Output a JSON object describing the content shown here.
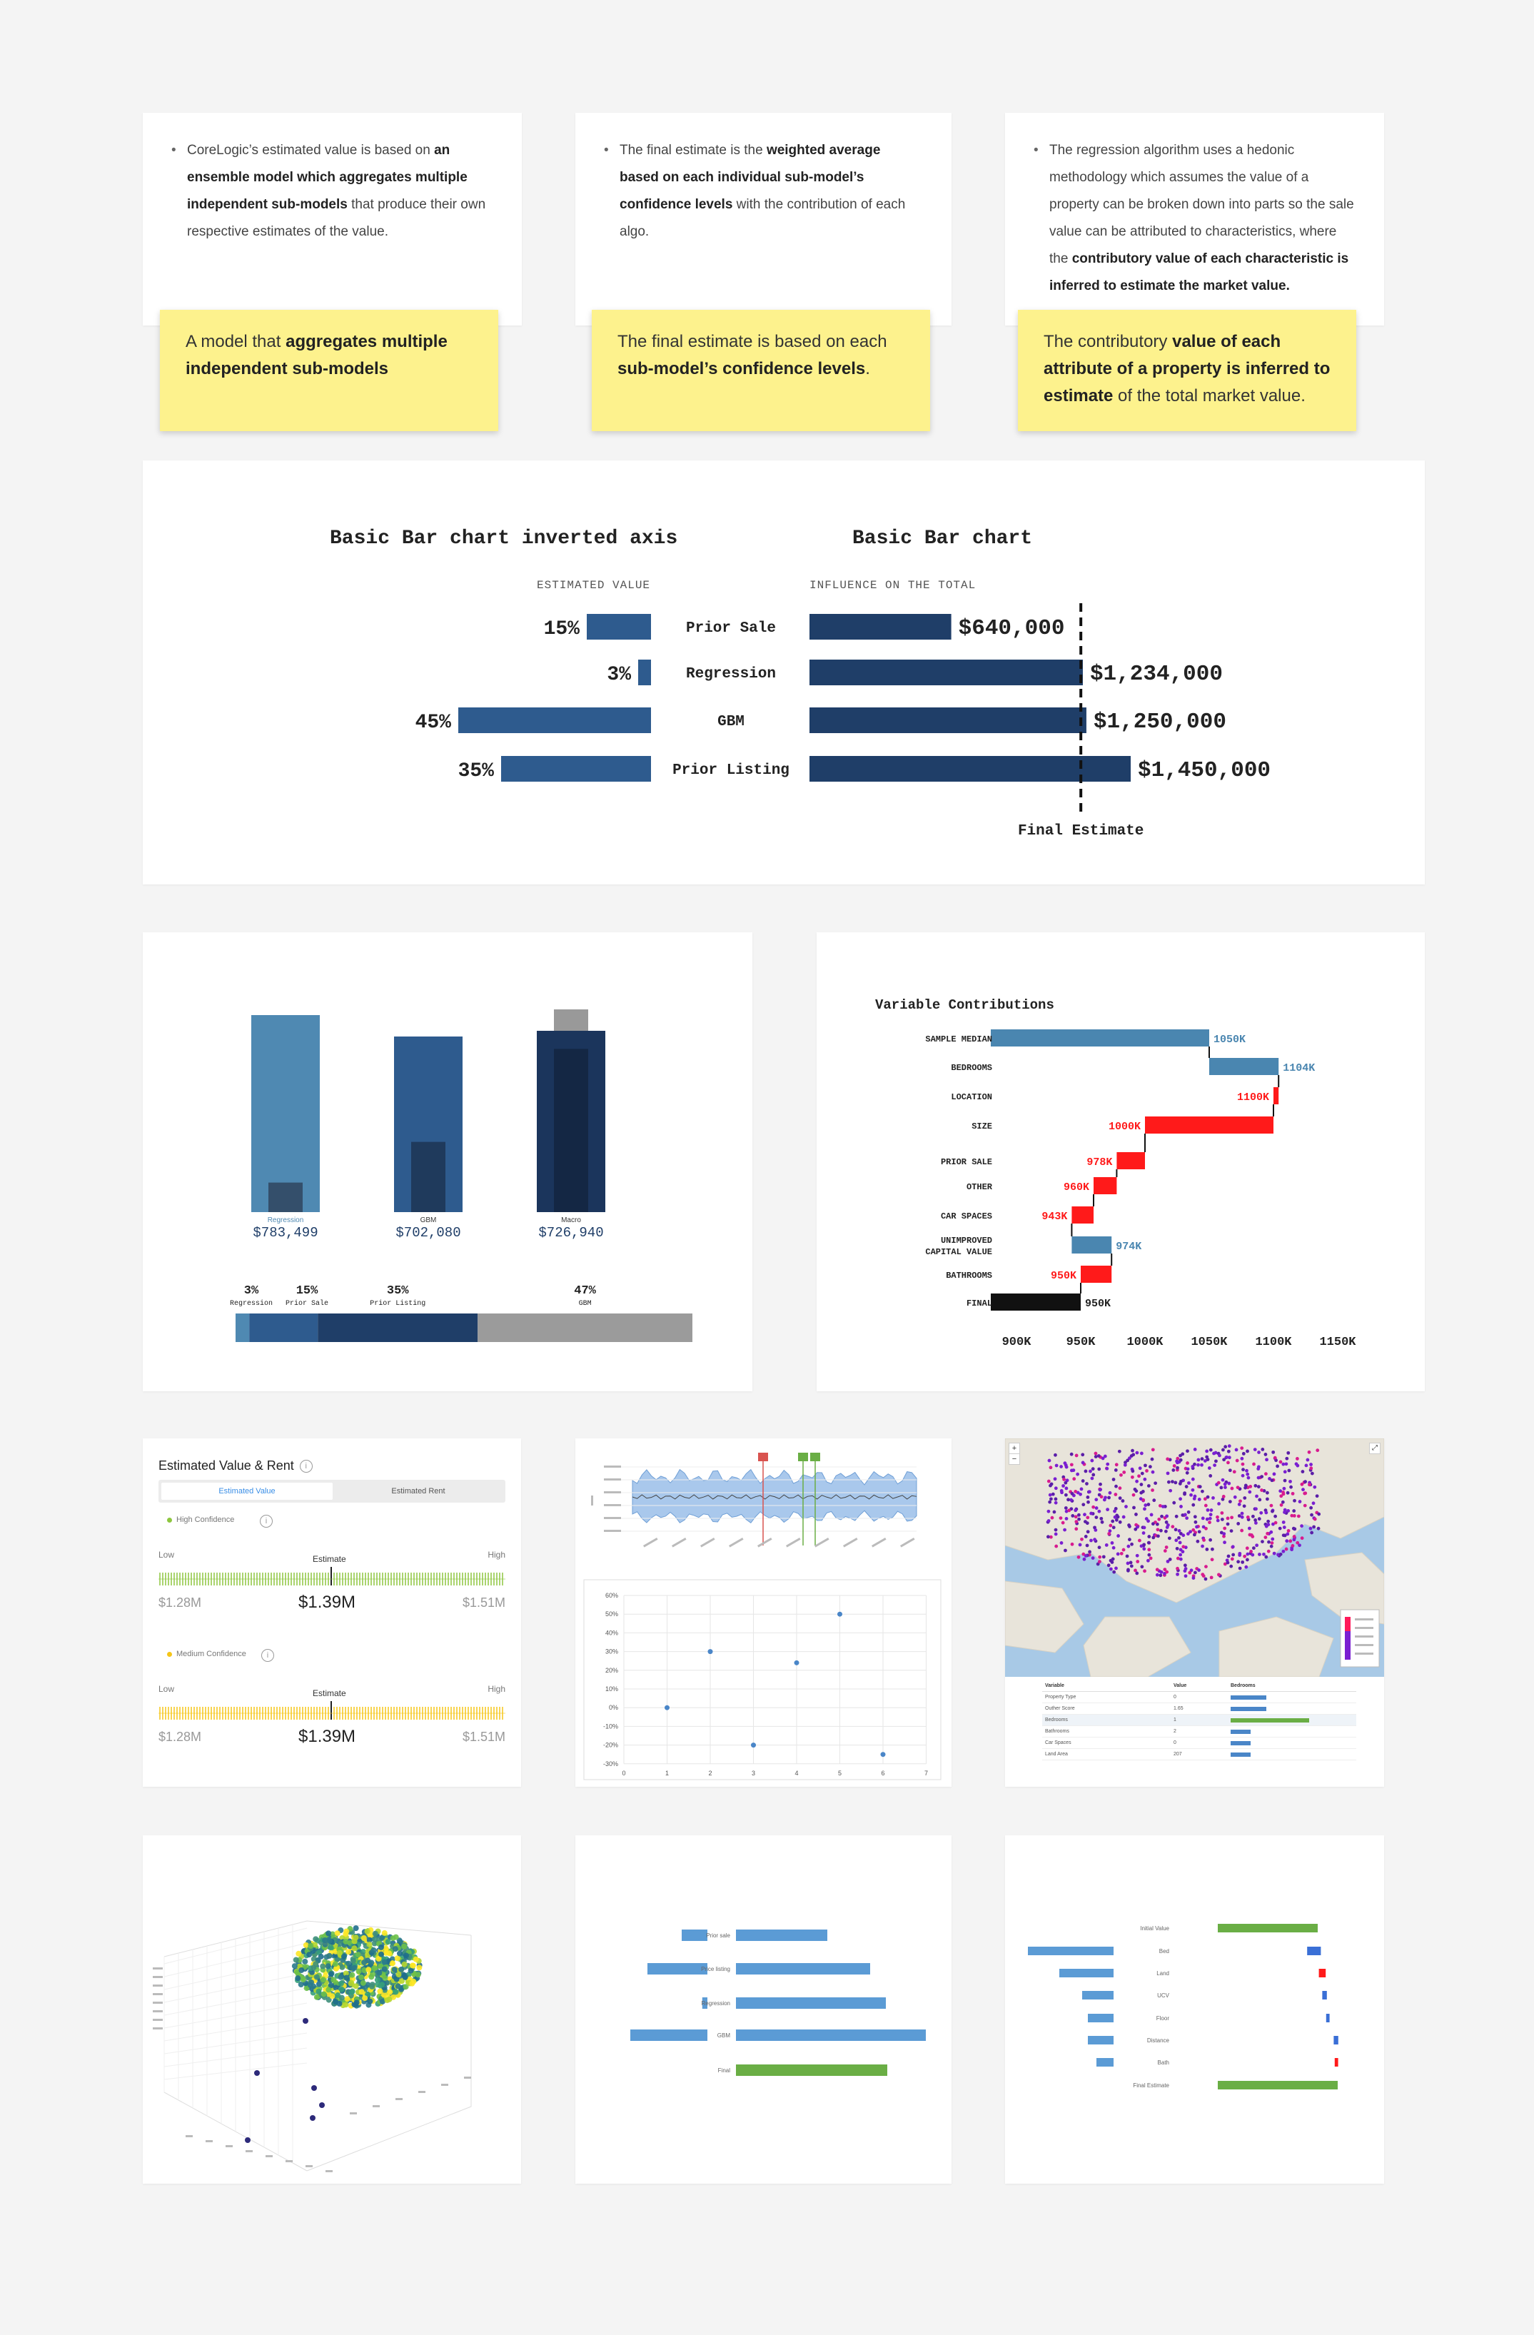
{
  "notes": [
    {
      "parts": [
        {
          "t": "CoreLogic’s estimated value is based on ",
          "b": false
        },
        {
          "t": "an ensemble model which aggregates multiple independent sub-models",
          "b": true
        },
        {
          "t": " that produce their own respective estimates of the value.",
          "b": false
        }
      ]
    },
    {
      "parts": [
        {
          "t": "The final estimate is the ",
          "b": false
        },
        {
          "t": "weighted average based on each individual sub-model’s confidence levels",
          "b": true
        },
        {
          "t": " with the contribution of each algo.",
          "b": false
        }
      ]
    },
    {
      "parts": [
        {
          "t": "The regression algorithm uses a hedonic methodology which assumes the value of a property can be broken down into parts so the sale value can be attributed to characteristics, where the ",
          "b": false
        },
        {
          "t": "contributory value of each characteristic is inferred to estimate the market value.",
          "b": true
        }
      ]
    }
  ],
  "stickies": [
    {
      "parts": [
        {
          "t": "A model that ",
          "b": false
        },
        {
          "t": "aggregates multiple independent sub-models",
          "b": true
        }
      ]
    },
    {
      "parts": [
        {
          "t": "The final estimate is based on each ",
          "b": false
        },
        {
          "t": "sub-model’s confidence levels",
          "b": true
        },
        {
          "t": ".",
          "b": false
        }
      ]
    },
    {
      "parts": [
        {
          "t": "The contributory ",
          "b": false
        },
        {
          "t": "value of each attribute of a property is inferred to estimate",
          "b": true
        },
        {
          "t": " of the total market value.",
          "b": false
        }
      ]
    }
  ],
  "bar_panel": {
    "left_title": "Basic Bar chart inverted axis",
    "right_title": "Basic Bar chart",
    "left_caption": "ESTIMATED VALUE",
    "right_caption": "INFLUENCE ON THE TOTAL",
    "final_label": "Final Estimate"
  },
  "waterfall": {
    "title": "Variable Contributions"
  },
  "estimate_widget": {
    "title": "Estimated Value & Rent",
    "tab_value": "Estimated Value",
    "tab_rent": "Estimated Rent",
    "high_conf": "High Confidence",
    "medium_conf": "Medium Confidence",
    "low": "Low",
    "high": "High",
    "estimate": "Estimate",
    "low_value": "$1.28M",
    "mid_value": "$1.39M",
    "high_value": "$1.51M",
    "high_color": "#8dc63f",
    "medium_color": "#f5c518"
  },
  "map_table": {
    "headers": [
      "Variable",
      "Value",
      "Bedrooms"
    ],
    "rows": [
      {
        "variable": "Property Type",
        "value": "0"
      },
      {
        "variable": "Outher Score",
        "value": "1.65"
      },
      {
        "variable": "Bedrooms",
        "value": "1"
      },
      {
        "variable": "Bathrooms",
        "value": "2"
      },
      {
        "variable": "Car Spaces",
        "value": "0"
      },
      {
        "variable": "Land Area",
        "value": "207"
      }
    ]
  },
  "colors": {
    "bar_mid": "#2e5b8e",
    "bar_dark": "#1f3e68",
    "bar_light": "#4f89b2",
    "positive": "#4a86b0",
    "negative": "#ff1a1a",
    "green": "#6aae45",
    "sticky": "#fdf28d"
  },
  "chart_data": [
    {
      "type": "bar",
      "title": "Basic Bar chart inverted axis",
      "xlabel": "ESTIMATED VALUE",
      "orientation": "horizontal-inverted",
      "categories": [
        "Prior Sale",
        "Regression",
        "GBM",
        "Prior Listing"
      ],
      "values": [
        15,
        3,
        45,
        35
      ],
      "value_labels": [
        "15%",
        "3%",
        "45%",
        "35%"
      ]
    },
    {
      "type": "bar",
      "title": "Basic Bar chart",
      "xlabel": "INFLUENCE ON THE TOTAL",
      "orientation": "horizontal",
      "categories": [
        "Prior Sale",
        "Regression",
        "GBM",
        "Prior Listing"
      ],
      "values": [
        640000,
        1234000,
        1250000,
        1450000
      ],
      "value_labels": [
        "$640,000",
        "$1,234,000",
        "$1,250,000",
        "$1,450,000"
      ],
      "annotation": "Final Estimate",
      "reference_value": 1225000
    },
    {
      "type": "bar",
      "categories": [
        "Regression",
        "GBM",
        "Macro"
      ],
      "values": [
        783499,
        702080,
        726940
      ],
      "value_labels": [
        "$783,499",
        "$702,080",
        "$726,940"
      ],
      "fill_fraction": [
        0.15,
        0.4,
        0.9
      ],
      "weights": [
        {
          "label": "Regression",
          "pct": "3%",
          "value": 3
        },
        {
          "label": "Prior Sale",
          "pct": "15%",
          "value": 15
        },
        {
          "label": "Prior Listing",
          "pct": "35%",
          "value": 35
        },
        {
          "label": "GBM",
          "pct": "47%",
          "value": 47
        }
      ]
    },
    {
      "type": "bar",
      "subtype": "waterfall",
      "title": "Variable Contributions",
      "categories": [
        "SAMPLE MEDIAN",
        "BEDROOMS",
        "LOCATION",
        "SIZE",
        "PRIOR SALE",
        "OTHER",
        "CAR SPACES",
        "UNIMPROVED CAPITAL VALUE",
        "BATHROOMS",
        "FINAL"
      ],
      "cumulative": [
        1050,
        1104,
        1100,
        1000,
        978,
        960,
        943,
        974,
        950,
        950
      ],
      "labels": [
        "1050K",
        "1104K",
        "1100K",
        "1000K",
        "978K",
        "960K",
        "943K",
        "974K",
        "950K",
        "950K"
      ],
      "x_ticks": [
        "900K",
        "950K",
        "1000K",
        "1050K",
        "1100K",
        "1150K"
      ],
      "xlim": [
        880,
        1160
      ]
    },
    {
      "type": "scatter",
      "x": [
        1,
        2,
        3,
        4,
        5,
        6
      ],
      "y": [
        0,
        30,
        -20,
        24,
        50,
        -25
      ],
      "y_ticks": [
        "60%",
        "50%",
        "40%",
        "30%",
        "20%",
        "10%",
        "0%",
        "-10%",
        "-20%",
        "-30%"
      ],
      "x_ticks": [
        "0",
        "1",
        "2",
        "3",
        "4",
        "5",
        "6",
        "7"
      ],
      "ylim": [
        -30,
        60
      ],
      "xlim": [
        0,
        7
      ]
    },
    {
      "type": "bar",
      "orientation": "diverging",
      "categories": [
        "Prior sale",
        "Price listing",
        "Regression",
        "GBM",
        "Final"
      ],
      "left_values": [
        15,
        35,
        3,
        45,
        0
      ],
      "right_values": [
        640,
        940,
        1050,
        1330,
        1060
      ]
    },
    {
      "type": "bar",
      "orientation": "diverging",
      "categories": [
        "Initial Value",
        "Bed",
        "Land",
        "UCV",
        "Floor",
        "Distance",
        "Bath",
        "Final Estimate"
      ],
      "left_values": [
        0,
        60,
        38,
        22,
        18,
        18,
        12,
        0
      ],
      "right_values": [
        100,
        12,
        6,
        4,
        3,
        4,
        3,
        120
      ]
    }
  ]
}
